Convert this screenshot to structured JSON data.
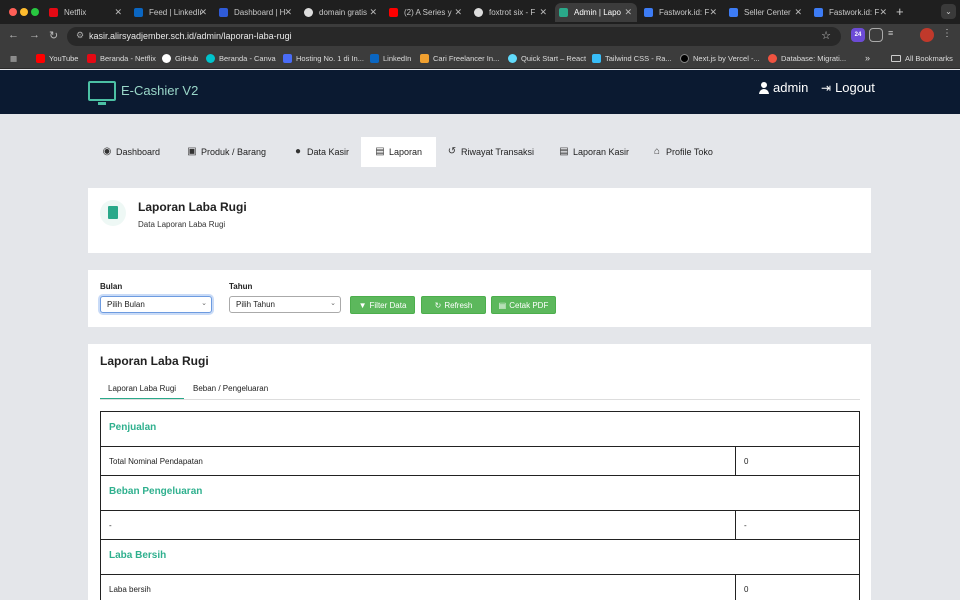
{
  "browser": {
    "tabs": [
      {
        "title": "Netflix",
        "color": "#e50914"
      },
      {
        "title": "Feed | LinkedIn",
        "color": "#0a66c2"
      },
      {
        "title": "Dashboard | Hosting",
        "color": "#2f5bd8"
      },
      {
        "title": "domain gratis",
        "color": "#ffffff"
      },
      {
        "title": "(2) A Series y",
        "color": "#ff0000"
      },
      {
        "title": "foxtrot six - F",
        "color": "#ffffff"
      },
      {
        "title": "Admin | Lapo",
        "color": "#2aa98a"
      },
      {
        "title": "Fastwork.id: F",
        "color": "#3d7cf5"
      },
      {
        "title": "Seller Center",
        "color": "#3d7cf5"
      },
      {
        "title": "Fastwork.id: F",
        "color": "#3d7cf5"
      }
    ],
    "url": "kasir.alirsyadjember.sch.id/admin/laporan-laba-rugi",
    "extension_badge": "24",
    "bookmarks": [
      {
        "label": "YouTube",
        "color": "#ff0000"
      },
      {
        "label": "Beranda - Netflix",
        "color": "#e50914"
      },
      {
        "label": "GitHub",
        "color": "#ffffff"
      },
      {
        "label": "Beranda - Canva",
        "color": "#00c4cc"
      },
      {
        "label": "Hosting No. 1 di In...",
        "color": "#4a6cf7"
      },
      {
        "label": "LinkedIn",
        "color": "#0a66c2"
      },
      {
        "label": "Cari Freelancer In...",
        "color": "#f0a030"
      },
      {
        "label": "Quick Start – React",
        "color": "#61dafb"
      },
      {
        "label": "Tailwind CSS - Ra...",
        "color": "#38bdf8"
      },
      {
        "label": "Next.js by Vercel -...",
        "color": "#000000"
      },
      {
        "label": "Database: Migrati...",
        "color": "#f05340"
      }
    ],
    "all_bookmarks": "All Bookmarks"
  },
  "app": {
    "brand": "E-Cashier V2",
    "user": "admin",
    "logout": "Logout"
  },
  "nav": [
    {
      "label": "Dashboard",
      "icon": "dashboard-icon"
    },
    {
      "label": "Produk / Barang",
      "icon": "box-icon"
    },
    {
      "label": "Data Kasir",
      "icon": "user-icon"
    },
    {
      "label": "Laporan",
      "icon": "clipboard-icon"
    },
    {
      "label": "Riwayat Transaksi",
      "icon": "history-icon"
    },
    {
      "label": "Laporan Kasir",
      "icon": "clipboard-icon"
    },
    {
      "label": "Profile Toko",
      "icon": "store-icon"
    }
  ],
  "page": {
    "title": "Laporan Laba Rugi",
    "subtitle": "Data Laporan Laba Rugi"
  },
  "filters": {
    "bulan_label": "Bulan",
    "bulan_value": "Pilih Bulan",
    "tahun_label": "Tahun",
    "tahun_value": "Pilih Tahun",
    "filter_btn": "Filter Data",
    "refresh_btn": "Refresh",
    "pdf_btn": "Cetak PDF"
  },
  "report": {
    "title": "Laporan Laba Rugi",
    "tabs": [
      "Laporan Laba Rugi",
      "Beban / Pengeluaran"
    ],
    "sections": [
      {
        "heading": "Penjualan",
        "row_label": "Total Nominal Pendapatan",
        "row_value": "0"
      },
      {
        "heading": "Beban Pengeluaran",
        "row_label": "-",
        "row_value": "-"
      },
      {
        "heading": "Laba Bersih",
        "row_label": "Laba bersih",
        "row_value": "0"
      }
    ]
  },
  "colors": {
    "accent": "#2fb08e",
    "header_bg": "#0b1a31",
    "button_green": "#5cb85c"
  }
}
